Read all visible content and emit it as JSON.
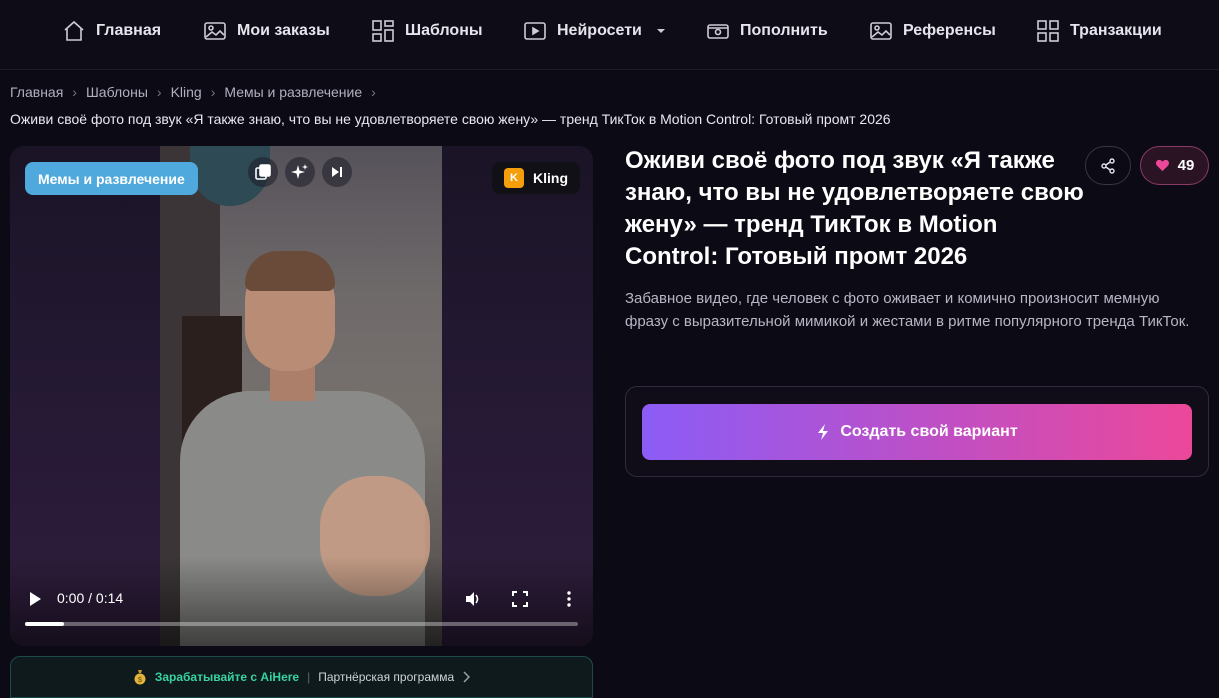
{
  "nav": {
    "items": [
      {
        "label": "Главная",
        "icon": "home-icon"
      },
      {
        "label": "Мои заказы",
        "icon": "image-icon"
      },
      {
        "label": "Шаблоны",
        "icon": "grid-icon"
      },
      {
        "label": "Нейросети",
        "icon": "video-play-icon"
      },
      {
        "label": "Пополнить",
        "icon": "wallet-icon"
      },
      {
        "label": "Референсы",
        "icon": "image-icon"
      },
      {
        "label": "Транзакции",
        "icon": "grid-icon"
      }
    ]
  },
  "breadcrumb": [
    "Главная",
    "Шаблоны",
    "Kling",
    "Мемы и развлечение"
  ],
  "page_subtitle": "Оживи своё фото под звук «Я также знаю, что вы не удовлетворяете свою жену» — тренд ТикТок в Motion Control: Готовый промт 2026",
  "video": {
    "category_chip": "Мемы и развлечение",
    "model_badge": {
      "logo_letter": "K",
      "label": "Kling"
    },
    "time": "0:00 / 0:14",
    "progress": 0.07
  },
  "affiliate": {
    "main_text": "Зарабатывайте с AiHere",
    "secondary_text": "Партнёрская программа"
  },
  "template": {
    "title": "Оживи своё фото под звук «Я также знаю, что вы не удовлетворяете свою жену» — тренд ТикТок в Motion Control: Готовый промт 2026",
    "likes": "49",
    "description": "Забавное видео, где человек с фото оживает и комично произносит мемную фразу с выразительной мимикой и жестами в ритме популярного тренда ТикТок.",
    "cta_label": "Создать свой вариант"
  },
  "colors": {
    "background": "#0c0a14",
    "category_chip": "#4fa9dd",
    "cta_gradient_start": "#8b5cf6",
    "cta_gradient_end": "#ec4899",
    "affiliate_accent": "#38d39f",
    "like_accent": "#ec4899"
  }
}
